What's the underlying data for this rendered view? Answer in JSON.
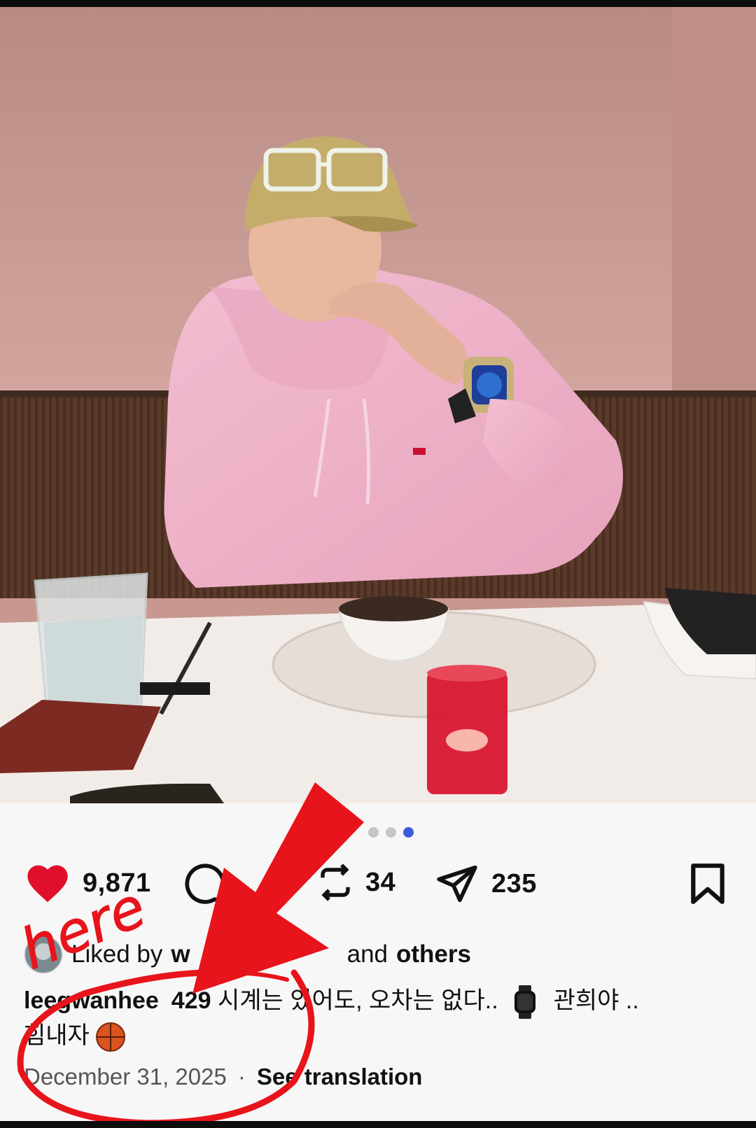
{
  "post": {
    "carousel": {
      "total": 3,
      "active_index": 2
    },
    "actions": {
      "like_count": "9,871",
      "repost_count": "34",
      "share_count": "235"
    },
    "liked_by": {
      "prefix": "Liked by",
      "user": "w",
      "suffix": "and",
      "others": "others"
    },
    "caption": {
      "username": "leegwanhee",
      "username_tail": "429",
      "line1_text": "시계는 있어도, 오차는 없다..",
      "line1_tail": "관희야 ..",
      "line2_text": "힘내자"
    },
    "date": "December 31, 2025",
    "separator": "·",
    "see_translation": "See translation"
  },
  "annotation": {
    "label": "here",
    "color": "#e8141b"
  },
  "colors": {
    "like": "#e0102a",
    "carousel_active": "#3b5bdb",
    "panel_bg": "#f7f7f7"
  },
  "icons": {
    "like": "heart-filled-icon",
    "comment": "comment-icon",
    "repost": "repost-icon",
    "share": "paper-plane-icon",
    "save": "bookmark-icon",
    "caption_emoji_1": "watch-emoji",
    "caption_emoji_2": "basketball-emoji"
  }
}
